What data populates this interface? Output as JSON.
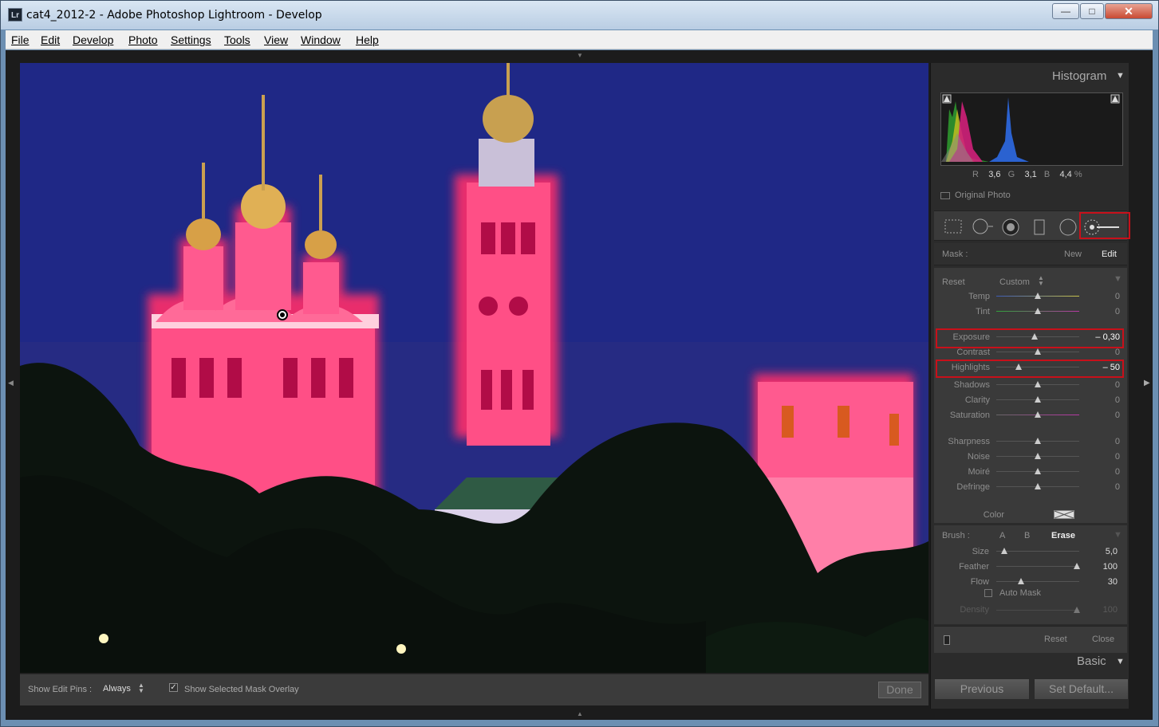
{
  "window": {
    "title": "cat4_2012-2 - Adobe Photoshop Lightroom - Develop",
    "icon_text": "Lr",
    "min_glyph": "—",
    "max_glyph": "□",
    "close_glyph": "✕"
  },
  "menu": [
    "File",
    "Edit",
    "Develop",
    "Photo",
    "Settings",
    "Tools",
    "View",
    "Window",
    "Help"
  ],
  "toolbar": {
    "pins_label": "Show Edit Pins :",
    "pins_value": "Always",
    "overlay_label": "Show Selected Mask Overlay",
    "overlay_checked": true,
    "done_label": "Done"
  },
  "histogram": {
    "title": "Histogram",
    "r_label": "R",
    "r": "3,6",
    "g_label": "G",
    "g": "3,1",
    "b_label": "B",
    "b": "4,4",
    "unit": "%",
    "original_photo": "Original Photo"
  },
  "mask": {
    "label": "Mask :",
    "new": "New",
    "edit": "Edit"
  },
  "edit": {
    "reset": "Reset",
    "preset": "Custom",
    "sliders": [
      {
        "label": "Temp",
        "value": "0",
        "pos": 0.5
      },
      {
        "label": "Tint",
        "value": "0",
        "pos": 0.5
      },
      {
        "label": "Exposure",
        "value": "– 0,30",
        "pos": 0.46
      },
      {
        "label": "Contrast",
        "value": "0",
        "pos": 0.5
      },
      {
        "label": "Highlights",
        "value": "– 50",
        "pos": 0.27
      },
      {
        "label": "Shadows",
        "value": "0",
        "pos": 0.5
      },
      {
        "label": "Clarity",
        "value": "0",
        "pos": 0.5
      },
      {
        "label": "Saturation",
        "value": "0",
        "pos": 0.5
      },
      {
        "label": "Sharpness",
        "value": "0",
        "pos": 0.5
      },
      {
        "label": "Noise",
        "value": "0",
        "pos": 0.5
      },
      {
        "label": "Moiré",
        "value": "0",
        "pos": 0.5
      },
      {
        "label": "Defringe",
        "value": "0",
        "pos": 0.5
      }
    ],
    "color_label": "Color"
  },
  "brush": {
    "label": "Brush :",
    "a": "A",
    "b": "B",
    "erase": "Erase",
    "sliders": [
      {
        "label": "Size",
        "value": "5,0",
        "pos": 0.1
      },
      {
        "label": "Feather",
        "value": "100",
        "pos": 0.97
      },
      {
        "label": "Flow",
        "value": "30",
        "pos": 0.3
      }
    ],
    "auto_mask": "Auto Mask",
    "density_label": "Density",
    "density_value": "100",
    "density_pos": 0.97
  },
  "panel_bottom": {
    "reset": "Reset",
    "close": "Close",
    "basic": "Basic",
    "previous": "Previous",
    "set_default": "Set Default..."
  }
}
